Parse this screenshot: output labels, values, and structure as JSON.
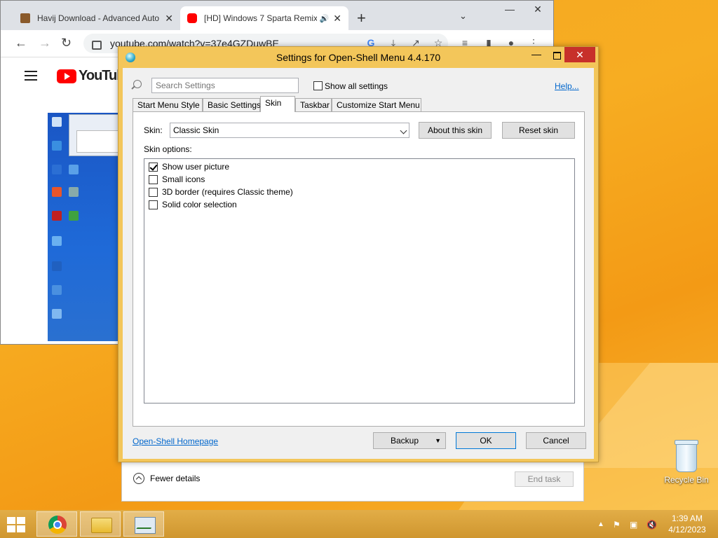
{
  "browser": {
    "tabs": [
      {
        "title": "Havij Download - Advanced Auto",
        "close": "✕",
        "favicon_color": "#8a5a2b"
      },
      {
        "title": "[HD] Windows 7 Sparta Remix",
        "close": "✕",
        "favicon_color": "#ff0000",
        "audio": "🔊"
      }
    ],
    "new_tab": "+",
    "tab_dropdown": "⌄",
    "window_controls": {
      "minimize": "—",
      "maximize": "❐",
      "close": "✕"
    },
    "url": "youtube.com/watch?v=37e4GZDuwBE",
    "site_logo_text": "YouTube"
  },
  "dialog": {
    "title": "Settings for Open-Shell Menu 4.4.170",
    "window_controls": {
      "minimize": "—",
      "close": "✕"
    },
    "search_placeholder": "Search Settings",
    "show_all_settings": "Show all settings",
    "help_link": "Help...",
    "tabs": [
      "Start Menu Style",
      "Basic Settings",
      "Skin",
      "Taskbar",
      "Customize Start Menu"
    ],
    "active_tab": "Skin",
    "skin_label": "Skin:",
    "skin_value": "Classic Skin",
    "about_skin_button": "About this skin",
    "reset_skin_button": "Reset skin",
    "skin_options_label": "Skin options:",
    "options": [
      {
        "label": "Show user picture",
        "checked": true
      },
      {
        "label": "Small icons",
        "checked": false
      },
      {
        "label": "3D border (requires Classic theme)",
        "checked": false
      },
      {
        "label": "Solid color selection",
        "checked": false
      }
    ],
    "homepage_link": "Open-Shell Homepage",
    "backup_button": "Backup",
    "ok_button": "OK",
    "cancel_button": "Cancel"
  },
  "task_manager": {
    "fewer_details": "Fewer details",
    "end_task": "End task"
  },
  "desktop": {
    "recycle_bin_label": "Recycle Bin"
  },
  "taskbar": {
    "clock_time": "1:39 AM",
    "clock_date": "4/12/2023",
    "tray_icons": [
      "chevron-up-icon",
      "flag-icon",
      "network-icon",
      "volume-muted-icon"
    ]
  },
  "colors": {
    "desktop": "#f5a623",
    "dialog_frame": "#f3c65a",
    "close_button": "#c7302a",
    "link": "#0066cc"
  }
}
